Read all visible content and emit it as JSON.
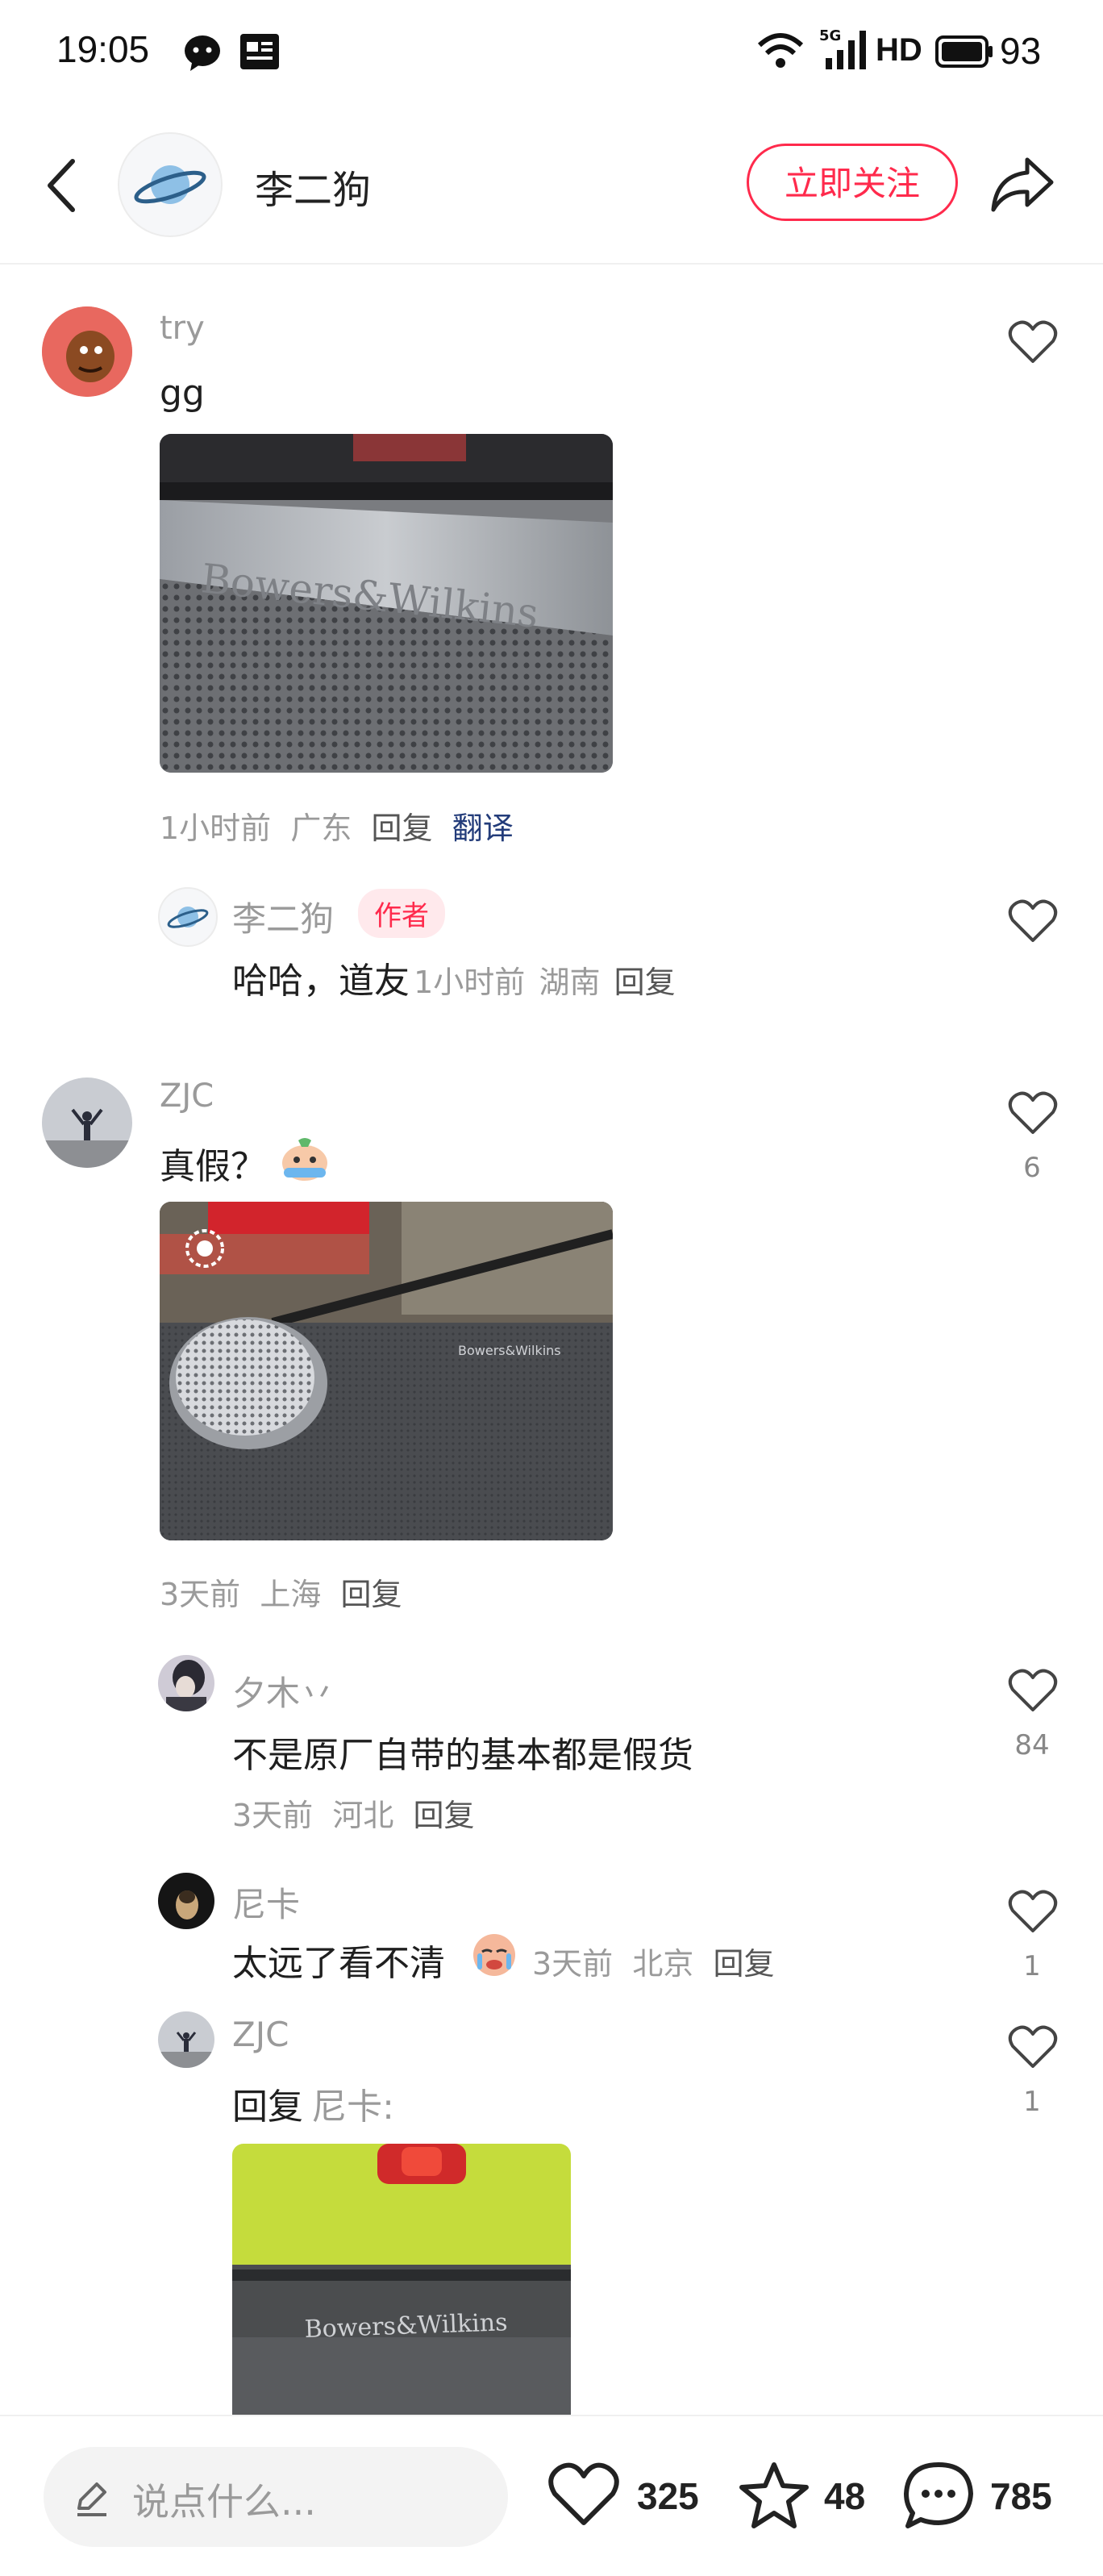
{
  "status_bar": {
    "time": "19:05",
    "network_label": "5G",
    "hd_label": "HD",
    "battery": "93"
  },
  "header": {
    "author_name": "李二狗",
    "follow_label": "立即关注"
  },
  "comments": [
    {
      "user": "try",
      "text": "gg",
      "image_text": "Bowers&Wilkins",
      "time": "1小时前",
      "location": "广东",
      "reply_label": "回复",
      "translate_label": "翻译",
      "replies": [
        {
          "user": "李二狗",
          "badge": "作者",
          "text": "哈哈，道友",
          "time": "1小时前",
          "location": "湖南",
          "reply_label": "回复"
        }
      ]
    },
    {
      "user": "ZJC",
      "text": "真假？",
      "like_count": "6",
      "image_text": "Bowers&Wilkins",
      "time": "3天前",
      "location": "上海",
      "reply_label": "回复",
      "replies": [
        {
          "user": "夕木丷",
          "text": "不是原厂自带的基本都是假货",
          "like_count": "84",
          "time": "3天前",
          "location": "河北",
          "reply_label": "回复"
        },
        {
          "user": "尼卡",
          "text": "太远了看不清",
          "like_count": "1",
          "time": "3天前",
          "location": "北京",
          "reply_label": "回复"
        },
        {
          "user": "ZJC",
          "reply_prefix": "回复",
          "reply_to": "尼卡:",
          "like_count": "1",
          "image_text": "Bowers&Wilkins"
        }
      ]
    }
  ],
  "bottom_bar": {
    "input_placeholder": "说点什么...",
    "likes": "325",
    "favorites": "48",
    "comments": "785"
  },
  "colors": {
    "accent": "#ff2a4c",
    "translate": "#233c7a",
    "muted_text": "#9a9a9a"
  }
}
